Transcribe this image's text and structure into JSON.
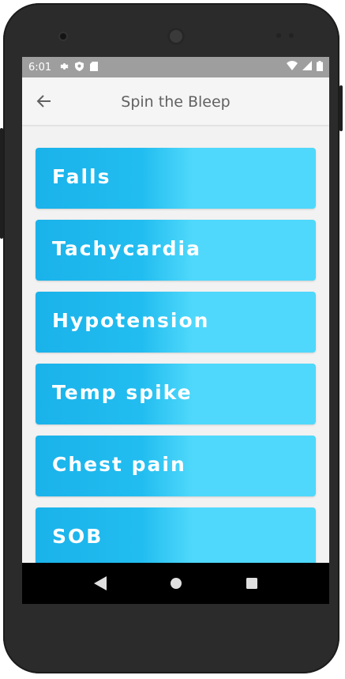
{
  "status_bar": {
    "time": "6:01",
    "icons": [
      "settings-icon",
      "shield-icon",
      "sd-card-icon",
      "wifi-icon",
      "signal-icon",
      "battery-icon"
    ]
  },
  "app_bar": {
    "title": "Spin the Bleep",
    "back_icon": "arrow-back-icon"
  },
  "items": [
    {
      "label": "Falls"
    },
    {
      "label": "Tachycardia"
    },
    {
      "label": "Hypotension"
    },
    {
      "label": "Temp spike"
    },
    {
      "label": "Chest pain"
    },
    {
      "label": "SOB"
    }
  ],
  "nav_bar": {
    "icons": [
      "back-triangle-icon",
      "home-circle-icon",
      "recents-square-icon"
    ]
  },
  "colors": {
    "item_gradient_start": "#1ab2ea",
    "item_gradient_end": "#4fd8fb",
    "status_bar": "#9e9e9e",
    "app_bar": "#f5f5f5"
  }
}
